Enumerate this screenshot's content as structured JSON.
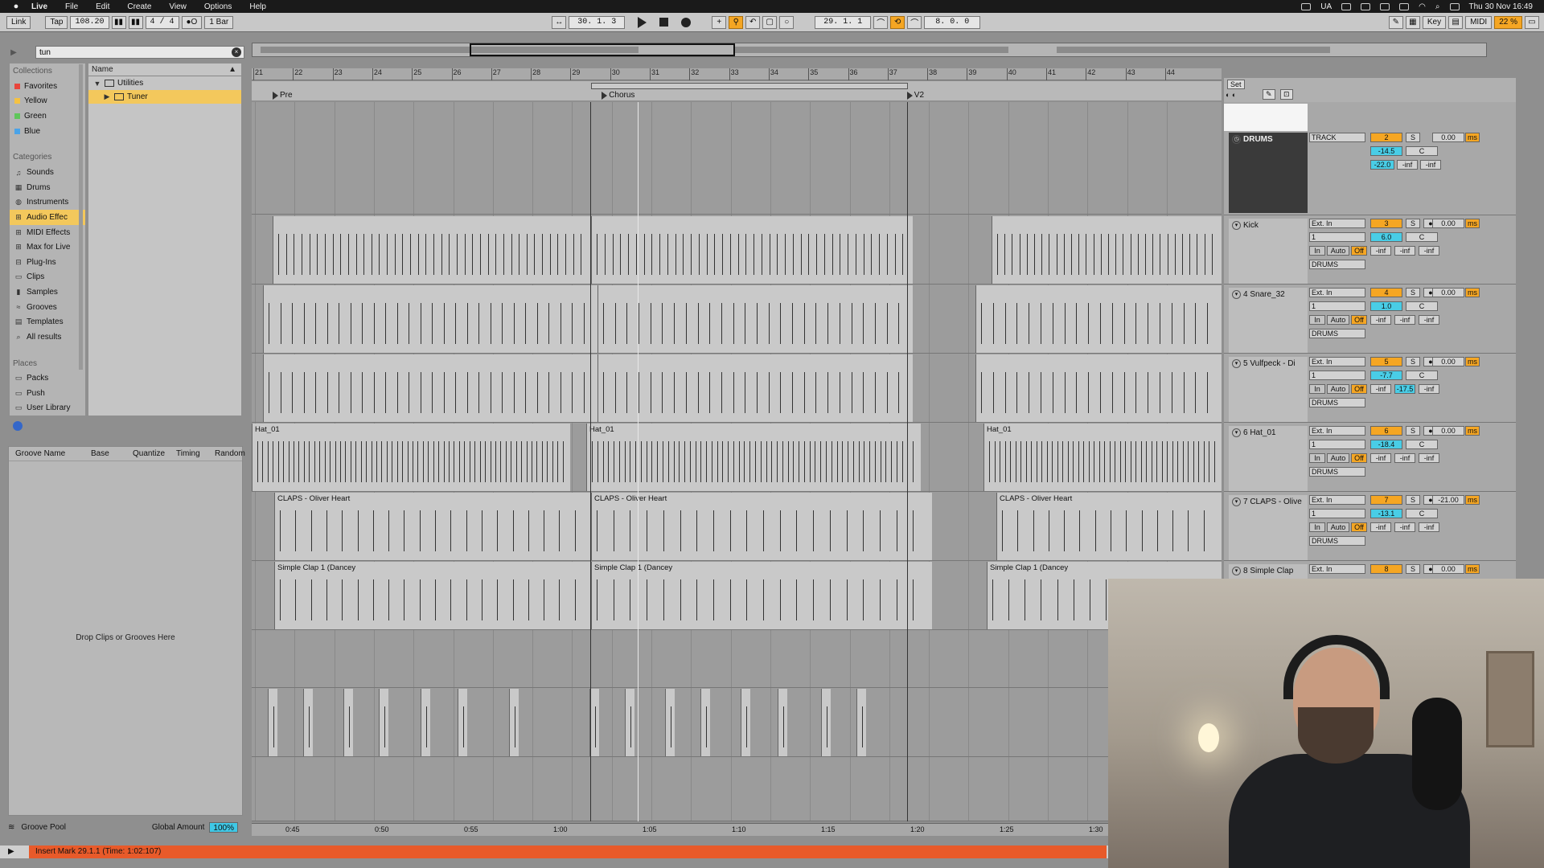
{
  "menubar": {
    "apple": "",
    "items": [
      "Live",
      "File",
      "Edit",
      "Create",
      "View",
      "Options",
      "Help"
    ],
    "input": "UA",
    "datetime": "Thu 30 Nov  16:49"
  },
  "control": {
    "link": "Link",
    "tap": "Tap",
    "tempo": "108.20",
    "signature": "4 / 4",
    "metro": "●O",
    "quantize": "1 Bar",
    "position": "30.  1.  3",
    "loop_start": "29.  1.  1",
    "loop_length": "8.  0.  0",
    "key": "Key",
    "midi": "MIDI",
    "cpu": "22 %"
  },
  "browser": {
    "search_value": "tun",
    "collections_title": "Collections",
    "collections": [
      {
        "label": "Favorites",
        "color": "#e8453c"
      },
      {
        "label": "Yellow",
        "color": "#f5c242"
      },
      {
        "label": "Green",
        "color": "#5fc65a"
      },
      {
        "label": "Blue",
        "color": "#4aa3e8"
      }
    ],
    "categories_title": "Categories",
    "categories": [
      "Sounds",
      "Drums",
      "Instruments",
      "Audio Effec",
      "MIDI Effects",
      "Max for Live",
      "Plug-Ins",
      "Clips",
      "Samples",
      "Grooves",
      "Templates",
      "All results"
    ],
    "selected_category": "Audio Effec",
    "places_title": "Places",
    "places": [
      "Packs",
      "Push",
      "User Library"
    ],
    "name_header": "Name",
    "files": [
      {
        "label": "Utilities",
        "expanded": true,
        "indent": 0
      },
      {
        "label": "Tuner",
        "expanded": false,
        "indent": 1
      }
    ]
  },
  "groove": {
    "columns": [
      "Groove Name",
      "Base",
      "Quantize",
      "Timing",
      "Random"
    ],
    "drop_text": "Drop Clips or Grooves Here",
    "footer_title": "Groove Pool",
    "amount_label": "Global Amount",
    "amount_value": "100%"
  },
  "arrangement": {
    "bars": [
      "21",
      "22",
      "23",
      "24",
      "25",
      "26",
      "27",
      "28",
      "29",
      "30",
      "31",
      "32",
      "33",
      "34",
      "35",
      "36",
      "37",
      "38",
      "39",
      "40",
      "41",
      "42",
      "43",
      "44"
    ],
    "locators": [
      "Pre",
      "Chorus",
      "V2"
    ],
    "times": [
      "0:45",
      "0:50",
      "0:55",
      "1:00",
      "1:05",
      "1:10",
      "1:15",
      "1:20",
      "1:25",
      "1:30"
    ],
    "clip_names": {
      "hat": "Hat_01",
      "claps": "CLAPS - Oliver Heart",
      "simple": "Simple Clap 1 (Dancey"
    }
  },
  "mixer": {
    "set_label": "Set",
    "tracks": [
      {
        "name": "DRUMS",
        "group": true,
        "input": "TRACK",
        "num": "2",
        "vol": "-14.5",
        "pan": "C",
        "peak": "-22.0",
        "l": "-inf",
        "r": "-inf",
        "delay": "0.00",
        "unit": "ms"
      },
      {
        "name": "Kick",
        "group": false,
        "input": "Ext. In",
        "chan": "1",
        "out": "DRUMS",
        "num": "3",
        "vol": "6.0",
        "pan": "C",
        "l": "-inf",
        "m": "-inf",
        "r": "-inf",
        "delay": "0.00",
        "unit": "ms"
      },
      {
        "name": "4 Snare_32",
        "group": false,
        "input": "Ext. In",
        "chan": "1",
        "out": "DRUMS",
        "num": "4",
        "vol": "1.0",
        "pan": "C",
        "l": "-inf",
        "m": "-inf",
        "r": "-inf",
        "delay": "0.00",
        "unit": "ms"
      },
      {
        "name": "5 Vulfpeck - Di",
        "group": false,
        "input": "Ext. In",
        "chan": "1",
        "out": "DRUMS",
        "num": "5",
        "vol": "-7.7",
        "pan": "C",
        "l": "-inf",
        "m": "-17.5",
        "r": "-inf",
        "delay": "0.00",
        "unit": "ms"
      },
      {
        "name": "6 Hat_01",
        "group": false,
        "input": "Ext. In",
        "chan": "1",
        "out": "DRUMS",
        "num": "6",
        "vol": "-18.4",
        "pan": "C",
        "l": "-inf",
        "m": "-inf",
        "r": "-inf",
        "delay": "0.00",
        "unit": "ms"
      },
      {
        "name": "7 CLAPS - Olive",
        "group": false,
        "input": "Ext. In",
        "chan": "1",
        "out": "DRUMS",
        "num": "7",
        "vol": "-13.1",
        "pan": "C",
        "l": "-inf",
        "m": "-inf",
        "r": "-inf",
        "delay": "-21.00",
        "unit": "ms"
      },
      {
        "name": "8 Simple Clap",
        "group": false,
        "input": "Ext. In",
        "num": "8",
        "delay": "0.00",
        "unit": "ms"
      }
    ],
    "labels": {
      "s": "S",
      "in": "In",
      "auto": "Auto",
      "off": "Off"
    }
  },
  "status": {
    "text": "Insert Mark 29.1.1 (Time: 1:02:107)"
  }
}
